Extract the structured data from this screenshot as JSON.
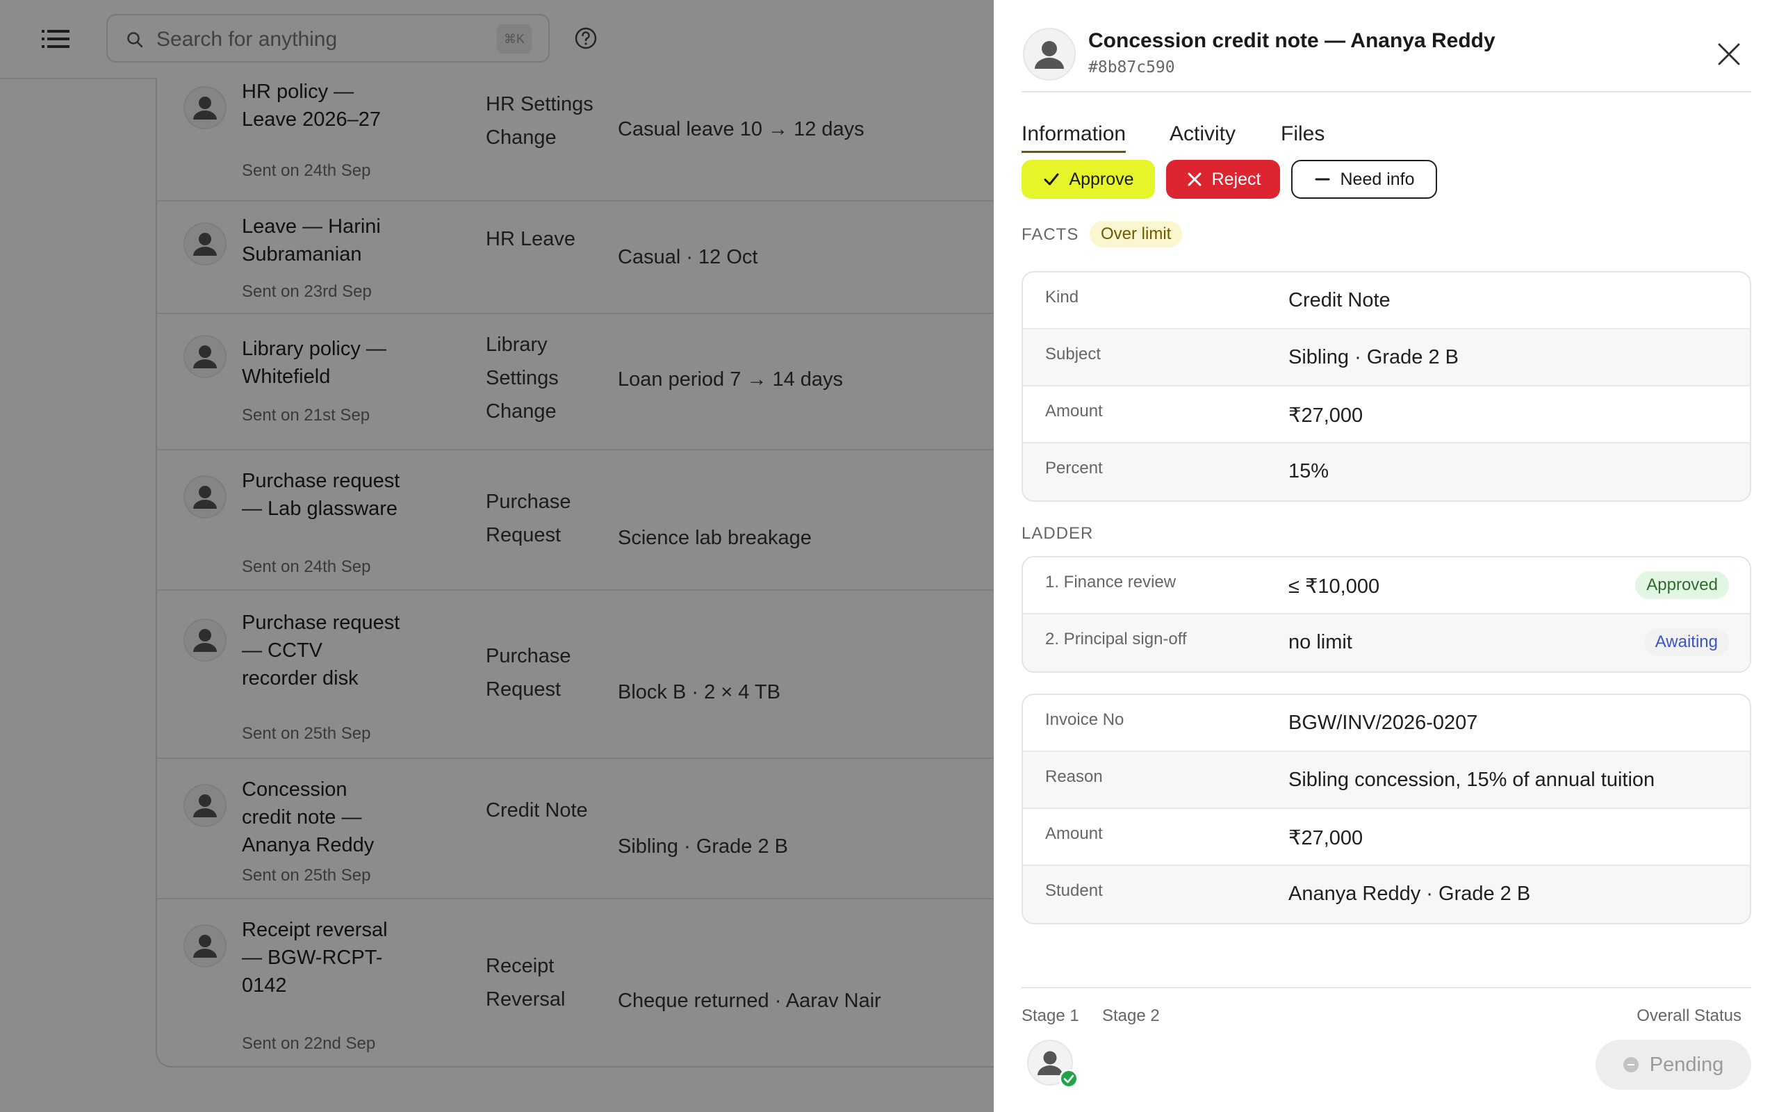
{
  "search": {
    "placeholder": "Search for anything",
    "shortcut": "⌘K"
  },
  "rows": [
    {
      "title": "HR policy — Leave 2026–27",
      "sent": "Sent on 24th Sep",
      "type": "HR Settings Change",
      "desc": "Casual leave 10 → 12 days"
    },
    {
      "title": "Leave — Harini Subramanian",
      "sent": "Sent on 23rd Sep",
      "type": "HR Leave",
      "desc": "Casual · 12 Oct"
    },
    {
      "title": "Library policy — Whitefield",
      "sent": "Sent on 21st Sep",
      "type": "Library Settings Change",
      "desc": "Loan period 7 → 14 days"
    },
    {
      "title": "Purchase request — Lab glassware",
      "sent": "Sent on 24th Sep",
      "type": "Purchase Request",
      "desc": "Science lab breakage"
    },
    {
      "title": "Purchase request — CCTV recorder disk",
      "sent": "Sent on 25th Sep",
      "type": "Purchase Request",
      "desc": "Block B · 2 × 4 TB"
    },
    {
      "title": "Concession credit note — Ananya Reddy",
      "sent": "Sent on 25th Sep",
      "type": "Credit Note",
      "desc": "Sibling · Grade 2 B"
    },
    {
      "title": "Receipt reversal — BGW-RCPT-0142",
      "sent": "Sent on 22nd Sep",
      "type": "Receipt Reversal",
      "desc": "Cheque returned · Aarav Nair"
    }
  ],
  "panel": {
    "title": "Concession credit note — Ananya Reddy",
    "id": "#8b87c590",
    "tabs": [
      "Information",
      "Activity",
      "Files"
    ],
    "actions": {
      "approve": "Approve",
      "reject": "Reject",
      "need_info": "Need info"
    },
    "facts_label": "FACTS",
    "facts_badge": "Over limit",
    "facts": [
      {
        "k": "Kind",
        "v": "Credit Note"
      },
      {
        "k": "Subject",
        "v": "Sibling · Grade 2 B"
      },
      {
        "k": "Amount",
        "v": "₹27,000"
      },
      {
        "k": "Percent",
        "v": "15%"
      }
    ],
    "ladder_label": "LADDER",
    "ladder": [
      {
        "k": "1. Finance review",
        "v": "≤ ₹10,000",
        "status": "Approved"
      },
      {
        "k": "2. Principal sign-off",
        "v": "no limit",
        "status": "Awaiting"
      }
    ],
    "details": [
      {
        "k": "Invoice No",
        "v": "BGW/INV/2026-0207"
      },
      {
        "k": "Reason",
        "v": "Sibling concession, 15% of annual tuition"
      },
      {
        "k": "Amount",
        "v": "₹27,000"
      },
      {
        "k": "Student",
        "v": "Ananya Reddy · Grade 2 B"
      }
    ],
    "footer": {
      "stage1": "Stage 1",
      "stage2": "Stage 2",
      "overall_label": "Overall Status",
      "overall_value": "Pending"
    }
  },
  "colors": {
    "approve": "#e6f52a",
    "reject": "#dd2531",
    "approved_bg": "#e3f5e3",
    "over_limit_bg": "#fbf6cf"
  }
}
